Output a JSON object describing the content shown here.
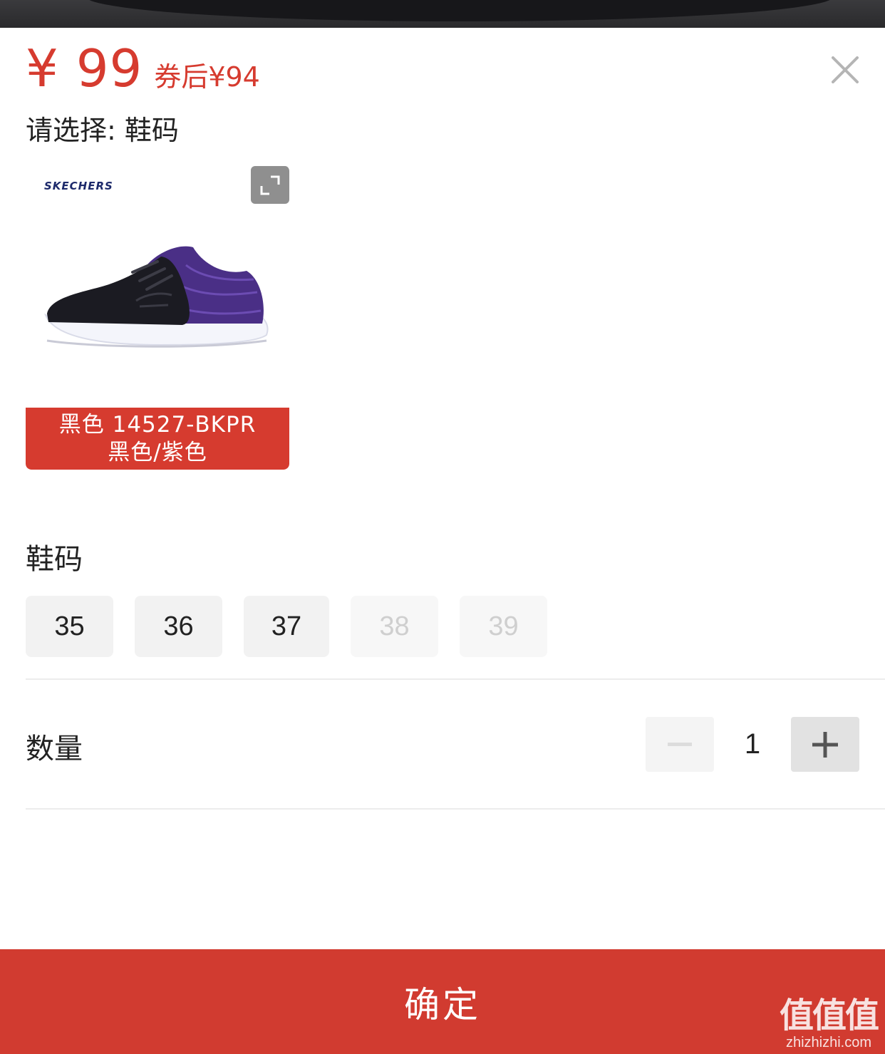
{
  "price": {
    "main": "¥ 99",
    "coupon": "券后¥94",
    "color": "#d63b2f"
  },
  "select_hint": "请选择: 鞋码",
  "sku": {
    "brand_logo": "SKECHERS",
    "label_line1": "黑色 14527-BKPR",
    "label_line2": "黑色/紫色",
    "expand_icon": "expand-icon"
  },
  "size": {
    "title": "鞋码",
    "options": [
      {
        "label": "35",
        "available": true
      },
      {
        "label": "36",
        "available": true
      },
      {
        "label": "37",
        "available": true
      },
      {
        "label": "38",
        "available": false
      },
      {
        "label": "39",
        "available": false
      }
    ]
  },
  "quantity": {
    "title": "数量",
    "value": "1"
  },
  "confirm_label": "确定",
  "watermark": {
    "big": "值值值",
    "small": "zhizhizhi.com"
  },
  "accent_color": "#d13b30"
}
